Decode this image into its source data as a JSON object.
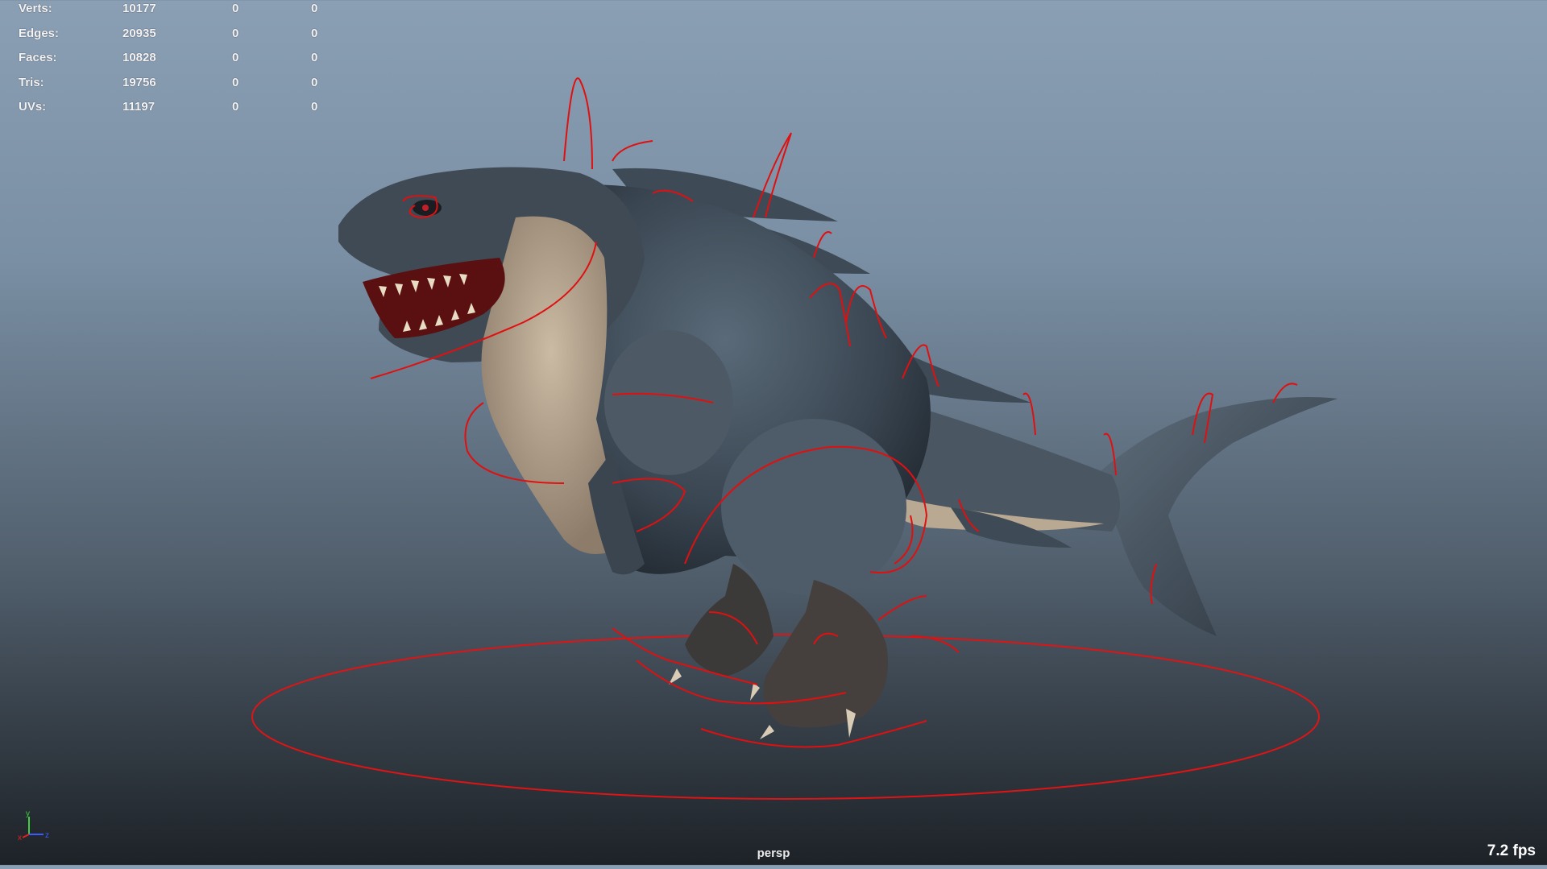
{
  "hud": {
    "rows": [
      {
        "label": "Verts:",
        "v1": "10177",
        "v2": "0",
        "v3": "0"
      },
      {
        "label": "Edges:",
        "v1": "20935",
        "v2": "0",
        "v3": "0"
      },
      {
        "label": "Faces:",
        "v1": "10828",
        "v2": "0",
        "v3": "0"
      },
      {
        "label": "Tris:",
        "v1": "19756",
        "v2": "0",
        "v3": "0"
      },
      {
        "label": "UVs:",
        "v1": "11197",
        "v2": "0",
        "v3": "0"
      }
    ]
  },
  "viewport": {
    "camera": "persp",
    "fps": "7.2 fps",
    "rig_color": "#e01010",
    "model_color": "#3c4a58"
  },
  "axis": {
    "x": "x",
    "y": "y",
    "z": "z"
  }
}
